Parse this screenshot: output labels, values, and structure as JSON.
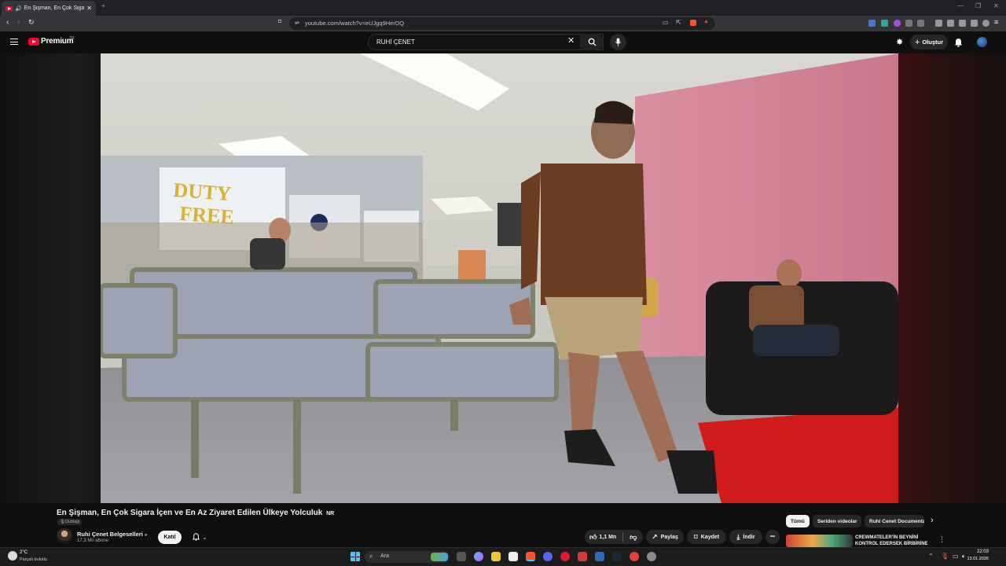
{
  "browser": {
    "tab_title": "En Şişman, En Çok Sigara İçen ve En Az Ziyaret Edilen Ülkeye Yolculuk - YouTube",
    "url": "youtube.com/watch?v=eUJgq9HerDQ",
    "new_tab_symbol": "+"
  },
  "youtube": {
    "logo_text": "Premium",
    "logo_region": "TR",
    "search_value": "RUHİ ÇENET",
    "create_label": "Oluştur"
  },
  "video": {
    "title": "En Şişman, En Çok Sigara İçen ve En Az Ziyaret Edilen Ülkeye Yolculuk",
    "rating_badge": "NR",
    "dubbed_label": "Dublajlı",
    "channel_name": "Ruhi Çenet Belgeselleri",
    "subscribers": "17,3 Mn abone",
    "join_label": "Katıl",
    "likes": "1,1 Mn",
    "share_label": "Paylaş",
    "save_label": "Kaydet",
    "download_label": "İndir",
    "more_label": "•••"
  },
  "recommendations": {
    "chips": [
      "Tümü",
      "Seriden videolar",
      "Ruhi Cenet Documentaries"
    ],
    "first_title": "CREWMATELER'İN BEYNİNİ KONTROL EDERSEK BİRBİRİNE"
  },
  "taskbar": {
    "temperature": "2°C",
    "weather_desc": "Parçalı bulutlu",
    "search_placeholder": "Ara",
    "time": "22:03",
    "date": "13.01.2026"
  },
  "colors": {
    "youtube_red": "#ff0033",
    "background": "#0f0f0f",
    "chip_active_bg": "#f1f1f1",
    "pill_bg": "#272727"
  }
}
